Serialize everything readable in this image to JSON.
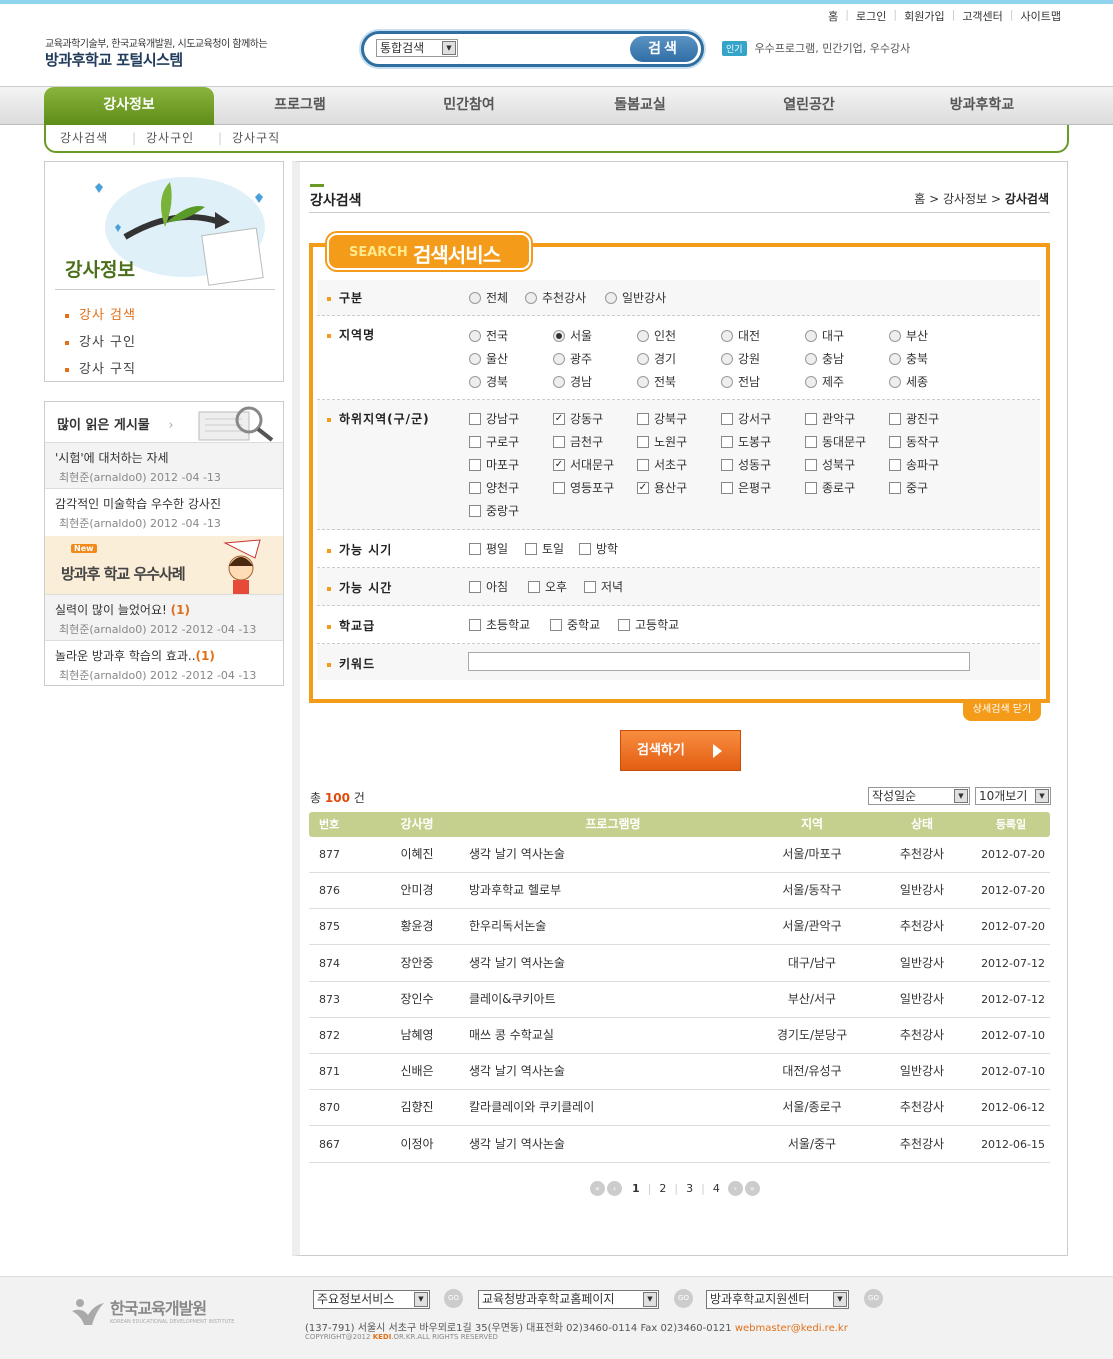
{
  "utility": [
    "홈",
    "로그인",
    "회원가입",
    "고객센터",
    "사이트맵"
  ],
  "header": {
    "org": "교육과학기술부, 한국교육개발원, 시도교육청이 함께하는",
    "title": "방과후학교 포털시스템",
    "search_select": "통합검색",
    "search_btn": "검색",
    "popular_tag": "인기",
    "popular_text": "우수프로그램, 민간기업, 우수강사"
  },
  "gnb": [
    "강사정보",
    "프로그램",
    "민간참여",
    "돌봄교실",
    "열린공간",
    "방과후학교"
  ],
  "lnb": [
    "강사검색",
    "강사구인",
    "강사구직"
  ],
  "side": {
    "title": "강사정보",
    "menu": [
      "강사 검색",
      "강사 구인",
      "강사 구직"
    ]
  },
  "popular": {
    "title": "많이 읽은 게시물",
    "items": [
      {
        "title": "'시험'에 대처하는 자세",
        "meta": "최현준(arnaldo0)  2012 -04 -13",
        "count": ""
      },
      {
        "title": "감각적인 미술학습 우수한 강사진",
        "meta": "최현준(arnaldo0)  2012 -04 -13",
        "count": ""
      },
      {
        "title": "실력이 많이 늘었어요!",
        "meta": "최현준(arnaldo0)  2012 -2012 -04 -13",
        "count": "(1)"
      },
      {
        "title": "놀라운 방과후 학습의 효과..",
        "meta": "최현준(arnaldo0)  2012 -2012 -04 -13",
        "count": "(1)"
      }
    ],
    "banner_new": "New",
    "banner_text": "방과후 학교 우수사례"
  },
  "page": {
    "title": "강사검색",
    "crumb_home": "홈",
    "crumb_mid": "강사정보",
    "crumb_cur": "강사검색"
  },
  "search": {
    "tab_en": "SEARCH",
    "tab_ko": "검색서비스",
    "labels": [
      "구분",
      "지역명",
      "하위지역(구/군)",
      "가능 시기",
      "가능 시간",
      "학교급",
      "키워드"
    ],
    "types": [
      "전체",
      "추천강사",
      "일반강사"
    ],
    "regions": [
      "전국",
      "서울",
      "인천",
      "대전",
      "대구",
      "부산",
      "울산",
      "광주",
      "경기",
      "강원",
      "충남",
      "충북",
      "경북",
      "경남",
      "전북",
      "전남",
      "제주",
      "세종"
    ],
    "region_selected": "서울",
    "districts": [
      "강남구",
      "강동구",
      "강북구",
      "강서구",
      "관악구",
      "광진구",
      "구로구",
      "금천구",
      "노원구",
      "도봉구",
      "동대문구",
      "동작구",
      "마포구",
      "서대문구",
      "서초구",
      "성동구",
      "성북구",
      "송파구",
      "양천구",
      "영등포구",
      "용산구",
      "은평구",
      "종로구",
      "중구",
      "중랑구"
    ],
    "districts_checked": [
      "강동구",
      "서대문구",
      "용산구"
    ],
    "periods": [
      "평일",
      "토일",
      "방학"
    ],
    "times": [
      "아침",
      "오후",
      "저녁"
    ],
    "schools": [
      "초등학교",
      "중학교",
      "고등학교"
    ],
    "keyword": "",
    "close_btn": "상세검색 닫기",
    "go_btn": "검색하기"
  },
  "list": {
    "total_prefix": "총",
    "total": "100",
    "total_suffix": "건",
    "sort": "작성일순",
    "per_page": "10개보기",
    "headers": [
      "번호",
      "강사명",
      "프로그램명",
      "지역",
      "상태",
      "등록일"
    ],
    "rows": [
      [
        "877",
        "이혜진",
        "생각 날기 역사논술",
        "서울/마포구",
        "추천강사",
        "2012-07-20"
      ],
      [
        "876",
        "안미경",
        "방과후학교 헬로부",
        "서울/동작구",
        "일반강사",
        "2012-07-20"
      ],
      [
        "875",
        "황윤경",
        "한우리독서논술",
        "서울/관악구",
        "추천강사",
        "2012-07-20"
      ],
      [
        "874",
        "장안중",
        "생각 날기 역사논술",
        "대구/남구",
        "일반강사",
        "2012-07-12"
      ],
      [
        "873",
        "장인수",
        "클레이&쿠키아트",
        "부산/서구",
        "일반강사",
        "2012-07-12"
      ],
      [
        "872",
        "남혜영",
        "매쓰 콩 수학교실",
        "경기도/분당구",
        "추천강사",
        "2012-07-10"
      ],
      [
        "871",
        "신배은",
        "생각 날기 역사논술",
        "대전/유성구",
        "일반강사",
        "2012-07-10"
      ],
      [
        "870",
        "김향진",
        "칼라클레이와 쿠키클레이",
        "서울/종로구",
        "추천강사",
        "2012-06-12"
      ],
      [
        "867",
        "이정아",
        "생각 날기 역사논술",
        "서울/중구",
        "추천강사",
        "2012-06-15"
      ]
    ],
    "pages": [
      "1",
      "2",
      "3",
      "4"
    ],
    "current_page": "1"
  },
  "footer": {
    "logo": "한국교육개발원",
    "logo_en": "KOREAN EDUCATIONAL DEVELOPMENT INSTITUTE",
    "selects": [
      "주요정보서비스",
      "교육청방과후학교홈페이지",
      "방과후학교지원센터"
    ],
    "go": "GO",
    "address": "(137-791) 서울시 서초구 바우뫼로1길 35(우면동)   대표전화 02)3460-0114    Fax 02)3460-0121",
    "email": "webmaster@kedi.re.kr",
    "copy_pre": "COPYRIGHT@2012 ",
    "copy_mid": "KEDI",
    "copy_post": ".OR.KR.ALL RIGHTS RESERVED"
  }
}
